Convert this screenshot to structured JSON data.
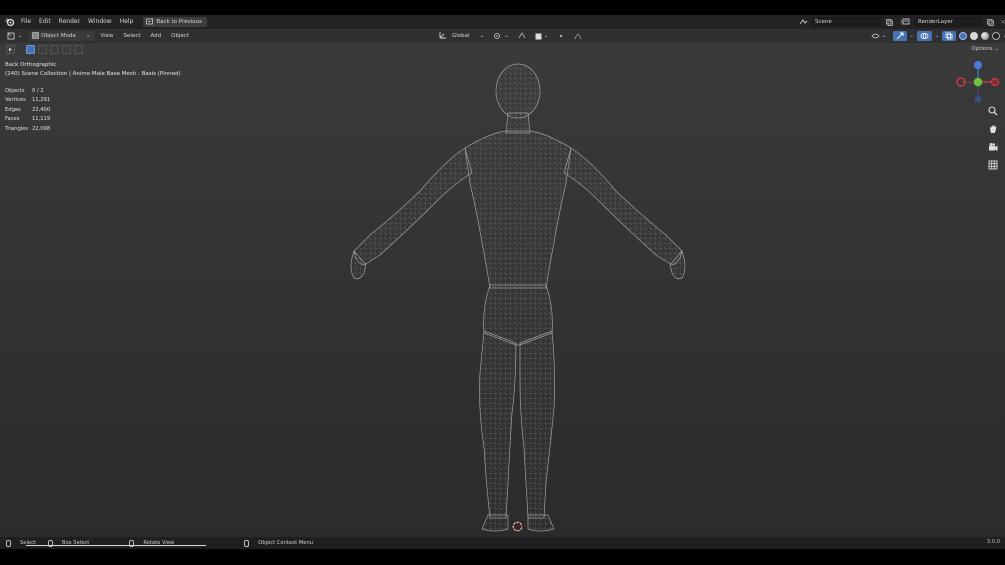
{
  "topbar": {
    "menus": [
      "File",
      "Edit",
      "Render",
      "Window",
      "Help"
    ],
    "back_label": "Back to Previous",
    "scene": "Scene",
    "render_layer": "RenderLayer"
  },
  "viewport_header": {
    "mode": "Object Mode",
    "menus": [
      "View",
      "Select",
      "Add",
      "Object"
    ],
    "transform_orientation": "Global",
    "options_label": "Options"
  },
  "viewport": {
    "view_name": "Back Orthographic",
    "collection_info": "(240) Scene Collection | Anime Male Base Mesh : Basis (Pinned)",
    "stats": [
      {
        "label": "Objects",
        "value": "0 / 2"
      },
      {
        "label": "Vertices",
        "value": "11,291"
      },
      {
        "label": "Edges",
        "value": "22,400"
      },
      {
        "label": "Faces",
        "value": "11,119"
      },
      {
        "label": "Triangles",
        "value": "22,098"
      }
    ],
    "gizmo_colors": {
      "x": "#e53b4d",
      "y": "#6ac33c",
      "z": "#4b7cdd"
    }
  },
  "statusbar": {
    "select": "Select",
    "box_select": "Box Select",
    "rotate_view": "Rotate View",
    "context_menu": "Object Context Menu",
    "version": "3.0.0"
  },
  "icons": [
    "blender-logo-icon",
    "back-icon",
    "scene-icon",
    "render-layer-icon",
    "mode-icon",
    "orientation-icon",
    "snap-icon",
    "magnet-icon",
    "proportional-icon",
    "overlay-icon",
    "xray-icon",
    "shading-wire-icon",
    "shading-solid-icon",
    "shading-material-icon",
    "shading-render-icon",
    "zoom-icon",
    "pan-hand-icon",
    "camera-icon",
    "grid-icon",
    "3d-cursor-icon"
  ]
}
